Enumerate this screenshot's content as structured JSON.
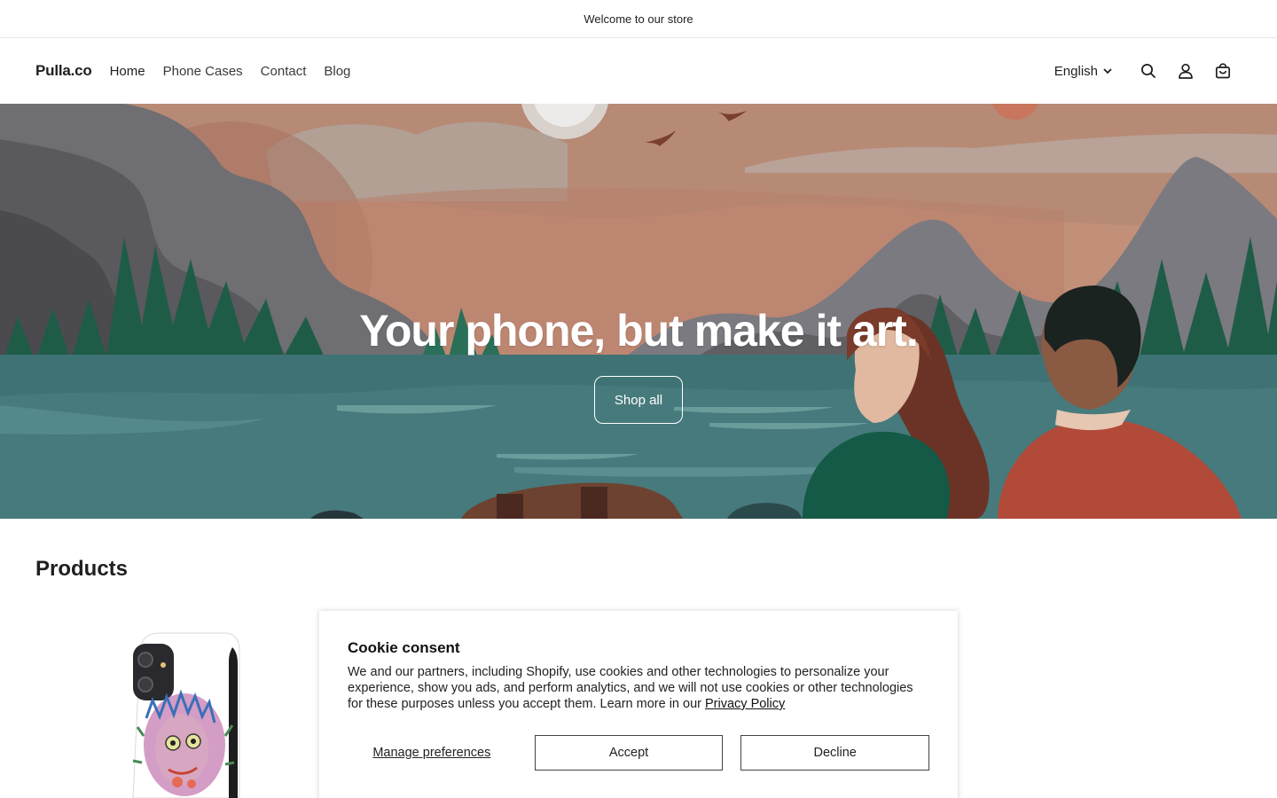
{
  "announcement": {
    "text": "Welcome to our store"
  },
  "header": {
    "logo": "Pulla.co",
    "nav": [
      "Home",
      "Phone Cases",
      "Contact",
      "Blog"
    ],
    "language": "English",
    "icons": [
      "search-icon",
      "account-icon",
      "cart-icon"
    ]
  },
  "hero": {
    "title": "Your phone, but make it art.",
    "button_label": "Shop all"
  },
  "products": {
    "title": "Products"
  },
  "cookie": {
    "title": "Cookie consent",
    "body": "We and our partners, including Shopify, use cookies and other technologies to personalize your experience, show you ads, and perform analytics, and we will not use cookies or other technologies for these purposes unless you accept them. Learn more in our ",
    "privacy_link": "Privacy Policy",
    "manage_label": "Manage preferences",
    "accept_label": "Accept",
    "decline_label": "Decline"
  }
}
